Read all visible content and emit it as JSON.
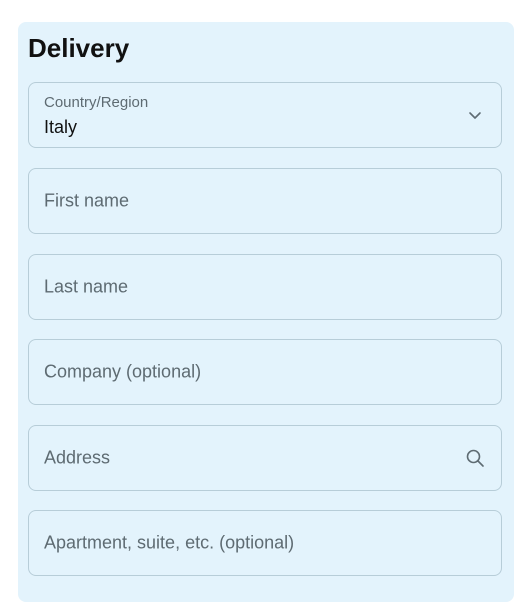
{
  "delivery": {
    "title": "Delivery",
    "country": {
      "label": "Country/Region",
      "value": "Italy",
      "icon": "chevron-down-icon"
    },
    "first_name": {
      "placeholder": "First name"
    },
    "last_name": {
      "placeholder": "Last name"
    },
    "company": {
      "placeholder": "Company (optional)"
    },
    "address": {
      "placeholder": "Address",
      "icon": "search-icon"
    },
    "apartment": {
      "placeholder": "Apartment, suite, etc. (optional)"
    }
  }
}
